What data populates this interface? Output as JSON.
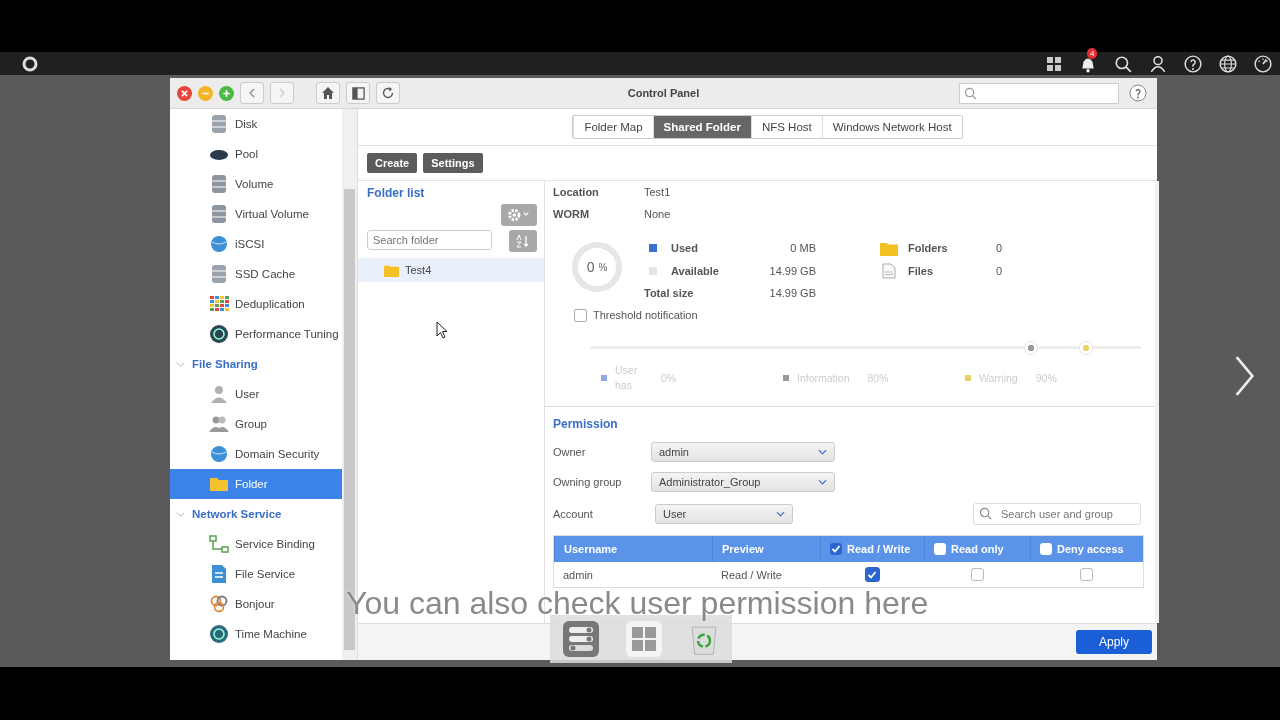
{
  "top_bar": {
    "notification_count": "4"
  },
  "window": {
    "title": "Control Panel"
  },
  "sidebar": {
    "items": [
      {
        "kind": "item",
        "label": "Disk",
        "selected": false
      },
      {
        "kind": "item",
        "label": "Pool",
        "selected": false
      },
      {
        "kind": "item",
        "label": "Volume",
        "selected": false
      },
      {
        "kind": "item",
        "label": "Virtual Volume",
        "selected": false
      },
      {
        "kind": "item",
        "label": "iSCSI",
        "selected": false
      },
      {
        "kind": "item",
        "label": "SSD Cache",
        "selected": false
      },
      {
        "kind": "item",
        "label": "Deduplication",
        "selected": false
      },
      {
        "kind": "item",
        "label": "Performance Tuning",
        "selected": false
      },
      {
        "kind": "category",
        "label": "File Sharing",
        "expanded": true
      },
      {
        "kind": "item",
        "label": "User",
        "selected": false
      },
      {
        "kind": "item",
        "label": "Group",
        "selected": false
      },
      {
        "kind": "item",
        "label": "Domain Security",
        "selected": false
      },
      {
        "kind": "item",
        "label": "Folder",
        "selected": true
      },
      {
        "kind": "category",
        "label": "Network Service",
        "expanded": true
      },
      {
        "kind": "item",
        "label": "Service Binding",
        "selected": false
      },
      {
        "kind": "item",
        "label": "File Service",
        "selected": false
      },
      {
        "kind": "item",
        "label": "Bonjour",
        "selected": false
      },
      {
        "kind": "item",
        "label": "Time Machine",
        "selected": false
      }
    ]
  },
  "tabs": [
    {
      "label": "Folder Map",
      "selected": false
    },
    {
      "label": "Shared Folder",
      "selected": true
    },
    {
      "label": "NFS Host",
      "selected": false
    },
    {
      "label": "Windows Network Host",
      "selected": false
    }
  ],
  "toolbar": {
    "buttons": [
      "Create",
      "Settings"
    ]
  },
  "folder_list": {
    "title": "Folder list",
    "search": {
      "placeholder": "Search folder"
    },
    "items": [
      {
        "name": "Test4",
        "selected": true
      }
    ]
  },
  "details": {
    "fields": [
      {
        "label": "Location",
        "value": "Test1"
      },
      {
        "label": "WORM",
        "value": "None"
      }
    ],
    "usage": {
      "percent": "0",
      "unit": "%",
      "level": 0,
      "rows": [
        {
          "label": "Used",
          "value": "0 MB",
          "color": "#3a6fd8"
        },
        {
          "label": "Available",
          "value": "14.99 GB",
          "color": "#e4e4e4"
        },
        {
          "label": "Total size",
          "value": "14.99 GB"
        }
      ],
      "counts": [
        {
          "kind": "folder",
          "label": "Folders",
          "value": "0"
        },
        {
          "kind": "file",
          "label": "Files",
          "value": "0"
        }
      ]
    },
    "threshold": {
      "label": "Threshold notification",
      "checked": false,
      "thumbs": [
        {
          "level": 0.8
        },
        {
          "level": 0.9
        }
      ],
      "legend": [
        {
          "label": "User has",
          "value": "0%",
          "color": "#8fa9e0"
        },
        {
          "label": "Information",
          "value": "80%",
          "color": "#9a9a9a"
        },
        {
          "label": "Warning",
          "value": "90%",
          "color": "#e8d36a"
        }
      ]
    }
  },
  "permission": {
    "title": "Permission",
    "owner": {
      "label": "Owner",
      "value": "admin"
    },
    "owning_group": {
      "label": "Owning group",
      "value": "Administrator_Group"
    },
    "account": {
      "label": "Account",
      "value": "User"
    },
    "search": {
      "placeholder": "Search user and group"
    },
    "columns": [
      {
        "label": "Username"
      },
      {
        "label": "Preview"
      },
      {
        "label": "Read / Write",
        "checked": true
      },
      {
        "label": "Read only",
        "checked": false
      },
      {
        "label": "Deny access",
        "checked": false
      }
    ],
    "rows": [
      {
        "username": "admin",
        "preview": "Read / Write",
        "read_write": true,
        "read_only": false,
        "deny_access": false
      }
    ]
  },
  "footer": {
    "apply": "Apply"
  },
  "caption": "You can also check user permission here"
}
